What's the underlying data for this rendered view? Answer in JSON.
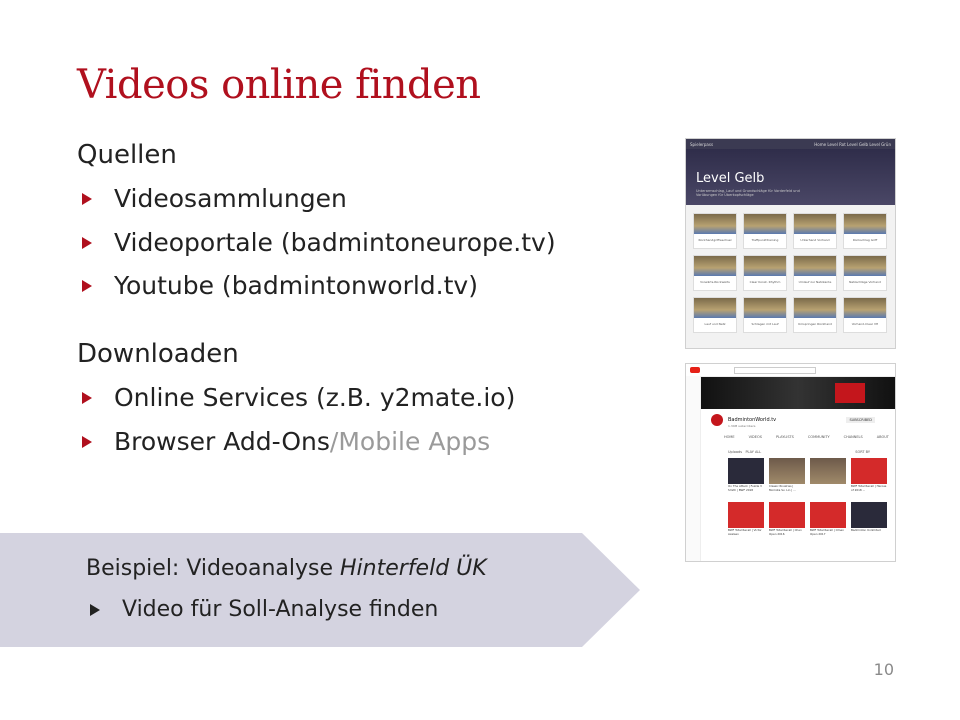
{
  "slide": {
    "title": "Videos online finden",
    "section1": {
      "heading": "Quellen",
      "items": [
        "Videosammlungen",
        "Videoportale (badmintoneurope.tv)",
        "Youtube (badmintonworld.tv)"
      ]
    },
    "section2": {
      "heading": "Downloaden",
      "items": [
        "Online Services (z.B. y2mate.io)"
      ],
      "addons_label": "Browser Add-Ons",
      "addons_separator": " / ",
      "addons_muted": "Mobile Apps"
    },
    "example": {
      "prefix": "Beispiel: Videoanalyse ",
      "italic": "Hinterfeld ÜK",
      "item": "Video für Soll-Analyse finden"
    },
    "page_number": "10"
  },
  "screenshot1": {
    "site_name": "Spielerpass",
    "nav_links": "Home  Level Rot  Level Gelb  Level Grün",
    "hero_title": "Level Gelb",
    "hero_subtitle": "Unterarmschlag, Lauf und Grundschläge für Vorderfeld und Vorübungen für Überkopfschläge",
    "cards": [
      "Rückhandgriffwechsel",
      "Treffpunkttraining",
      "Unterhand Vorhand",
      "Rückschlag Griff",
      "Vorwärts-Rückwärts",
      "Clear Konst. Rhythm",
      "Umlauf zur Netzkante",
      "Netzschläge Vorhand",
      "Lauf und Netz",
      "Schlagen mit Lauf",
      "Umspringen Rückhand",
      "Vorhand-Clear VH"
    ]
  },
  "screenshot2": {
    "channel_name": "BadmintonWorld.tv",
    "subscribers": "1.34M subscribers",
    "subscribe_label": "SUBSCRIBED",
    "tabs": [
      "HOME",
      "VIDEOS",
      "PLAYLISTS",
      "COMMUNITY",
      "CHANNELS",
      "ABOUT"
    ],
    "uploads_label": "Uploads",
    "play_all_label": "PLAY ALL",
    "sort_label": "SORT BY",
    "videos": [
      "On The Attack | Fuzzle V Smith | BWF 2018",
      "Classic Rivalries | Momota Sv. Lin | ...",
      "BWF Total Recall | Heroes of 2018 ...",
      "BWF Total Recall | Victor Axelsen",
      "BWF Total Recall | Chen Open 2016",
      "BWF Total Recall | Omen Open 2017",
      "Badminton Unlimited"
    ]
  }
}
